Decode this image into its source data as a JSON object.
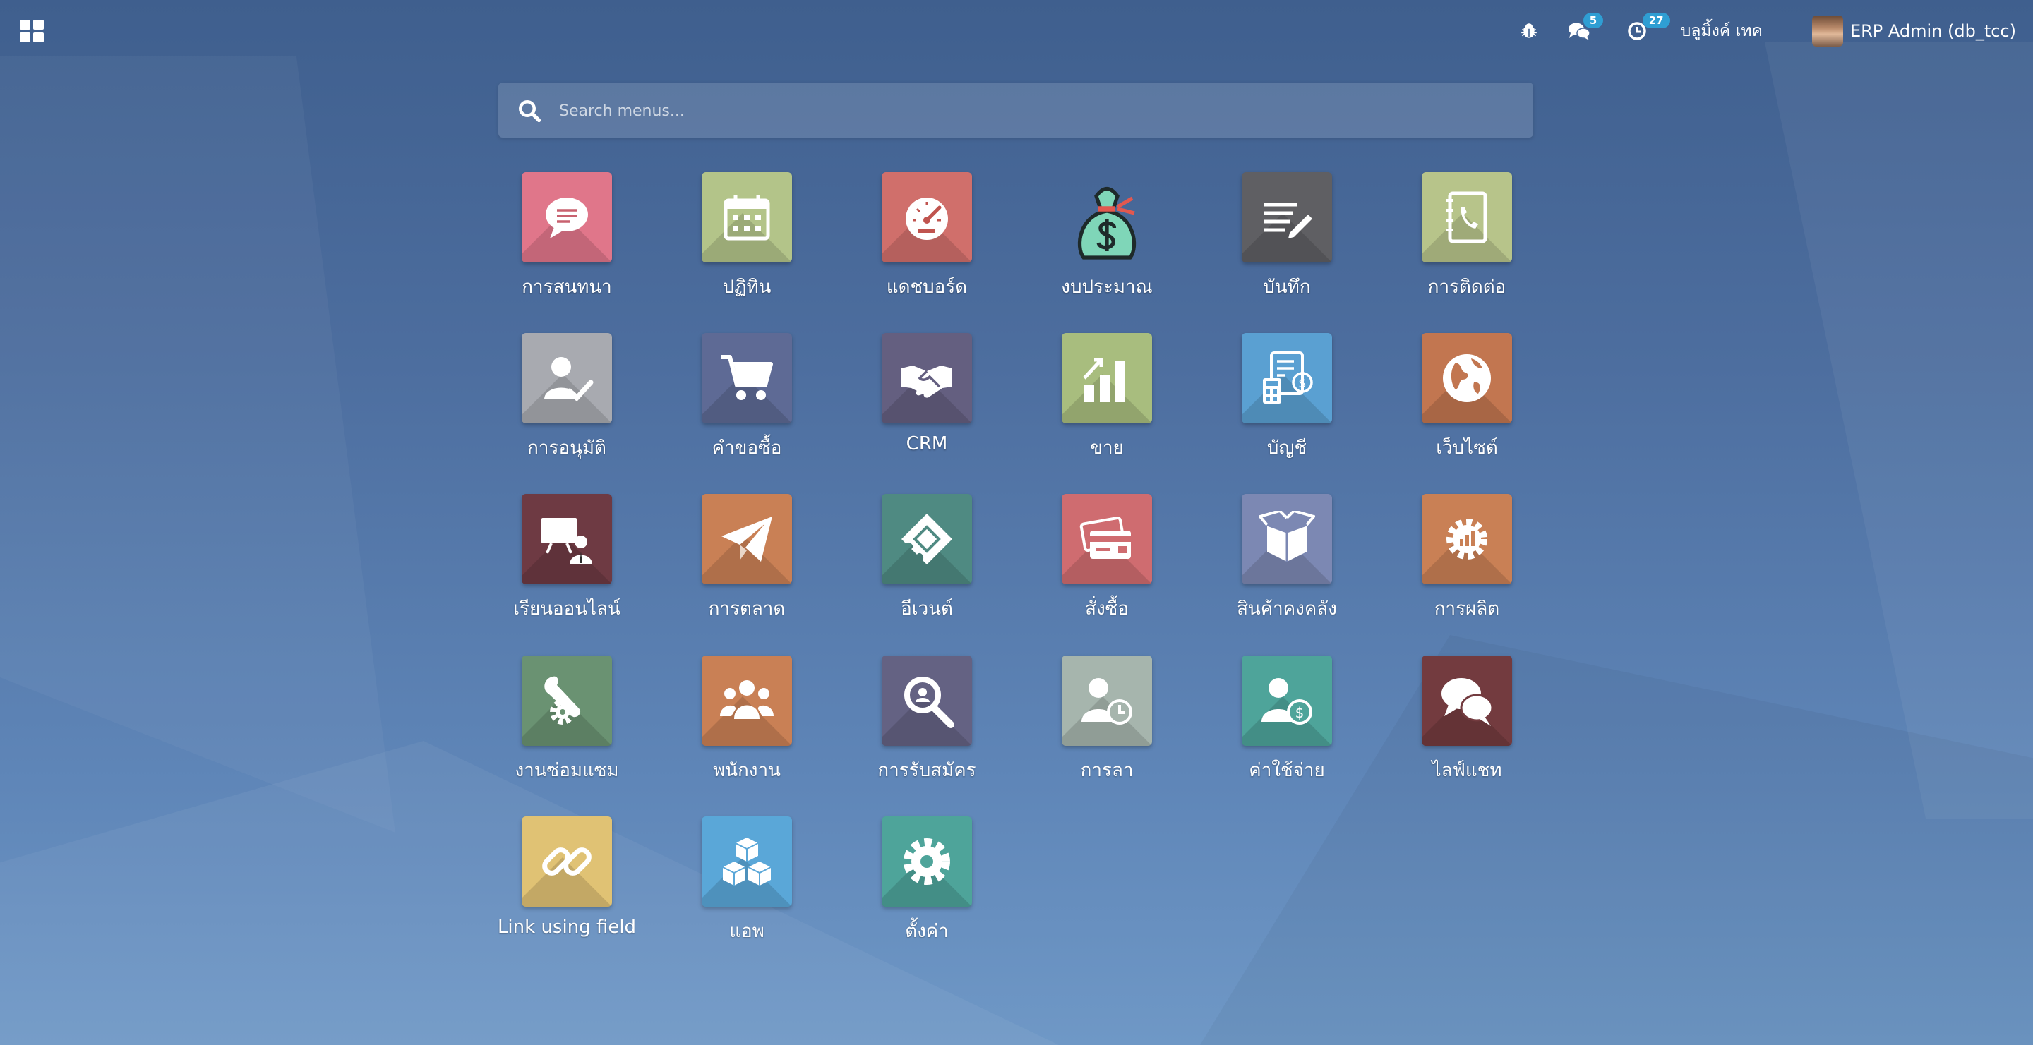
{
  "topbar": {
    "company": "บลูมิ้งค์ เทค",
    "user": "ERP Admin (db_tcc)",
    "messages_count": "5",
    "activities_count": "27"
  },
  "search": {
    "placeholder": "Search menus..."
  },
  "apps": [
    {
      "label": "การสนทนา",
      "icon": "chat-bubble-icon",
      "color": "#e0768a"
    },
    {
      "label": "ปฏิทิน",
      "icon": "calendar-icon",
      "color": "#b3c489"
    },
    {
      "label": "แดชบอร์ด",
      "icon": "gauge-icon",
      "color": "#d06f6b"
    },
    {
      "label": "งบประมาณ",
      "icon": "money-bag-icon",
      "color": "#7fd6b8"
    },
    {
      "label": "บันทึก",
      "icon": "note-pencil-icon",
      "color": "#5f5f63"
    },
    {
      "label": "การติดต่อ",
      "icon": "contact-book-icon",
      "color": "#b7c48a"
    },
    {
      "label": "การอนุมัติ",
      "icon": "user-check-icon",
      "color": "#a8aab0"
    },
    {
      "label": "คำขอซื้อ",
      "icon": "cart-icon",
      "color": "#5e6a95"
    },
    {
      "label": "CRM",
      "icon": "handshake-icon",
      "color": "#645f80"
    },
    {
      "label": "ขาย",
      "icon": "sales-chart-icon",
      "color": "#a8bd7e"
    },
    {
      "label": "บัญชี",
      "icon": "invoice-calculator-icon",
      "color": "#5aa0d2"
    },
    {
      "label": "เว็บไซต์",
      "icon": "globe-icon",
      "color": "#c27650"
    },
    {
      "label": "เรียนออนไลน์",
      "icon": "presentation-icon",
      "color": "#6e3a43"
    },
    {
      "label": "การตลาด",
      "icon": "paper-plane-icon",
      "color": "#c98055"
    },
    {
      "label": "อีเวนต์",
      "icon": "ticket-icon",
      "color": "#4f8a82"
    },
    {
      "label": "สั่งซื้อ",
      "icon": "credit-card-icon",
      "color": "#cf6c70"
    },
    {
      "label": "สินค้าคงคลัง",
      "icon": "open-box-icon",
      "color": "#7c88b3"
    },
    {
      "label": "การผลิต",
      "icon": "gear-chart-icon",
      "color": "#c98055"
    },
    {
      "label": "งานซ่อมแซม",
      "icon": "wrench-gear-icon",
      "color": "#6a9272"
    },
    {
      "label": "พนักงาน",
      "icon": "team-icon",
      "color": "#c98055"
    },
    {
      "label": "การรับสมัคร",
      "icon": "magnifier-icon",
      "color": "#646283"
    },
    {
      "label": "การลา",
      "icon": "user-clock-icon",
      "color": "#a6b5ad"
    },
    {
      "label": "ค่าใช้จ่าย",
      "icon": "user-dollar-icon",
      "color": "#4ea49a"
    },
    {
      "label": "ไลฟ์แชท",
      "icon": "chat-bubbles-icon",
      "color": "#733b3f"
    },
    {
      "label": "Link using field",
      "icon": "link-icon",
      "color": "#e0c274"
    },
    {
      "label": "แอพ",
      "icon": "cubes-icon",
      "color": "#5aa7d8"
    },
    {
      "label": "ตั้งค่า",
      "icon": "gear-icon",
      "color": "#4ea49a"
    }
  ]
}
